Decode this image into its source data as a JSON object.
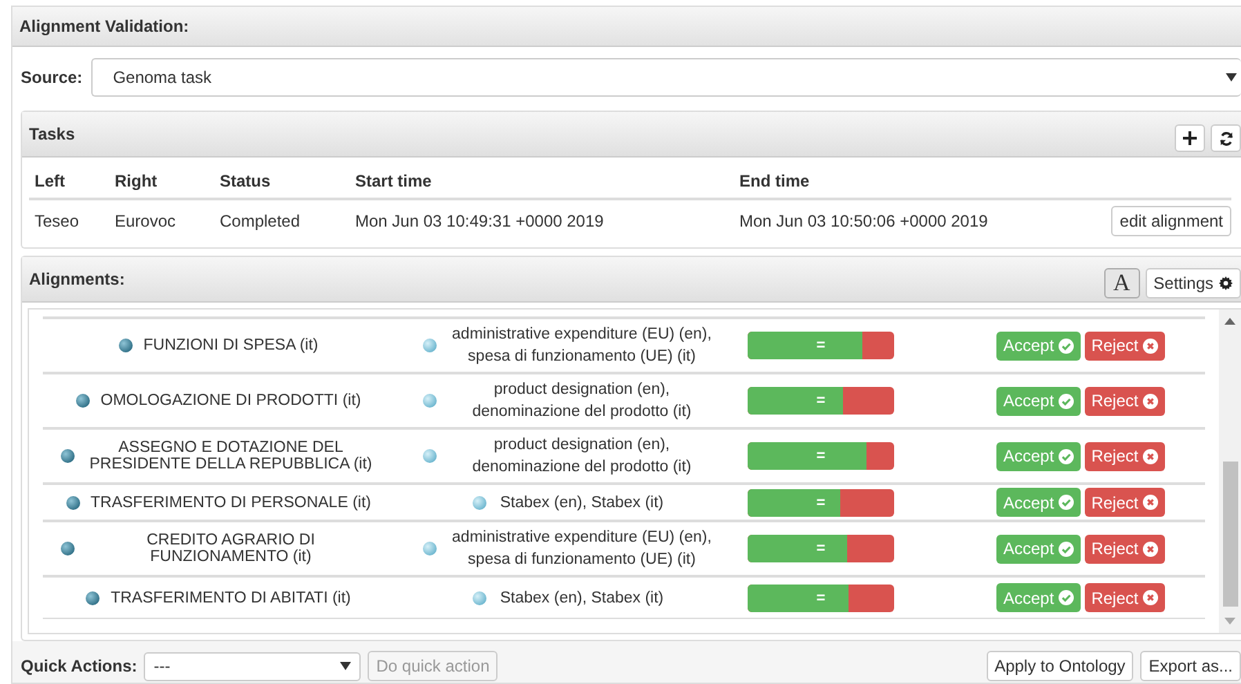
{
  "title": "Alignment Validation:",
  "source": {
    "label": "Source:",
    "value": "Genoma task"
  },
  "tasks": {
    "title": "Tasks",
    "columns": [
      "Left",
      "Right",
      "Status",
      "Start time",
      "End time"
    ],
    "rows": [
      {
        "cells": [
          "Teseo",
          "Eurovoc",
          "Completed",
          "Mon Jun 03 10:49:31 +0000 2019",
          "Mon Jun 03 10:50:06 +0000 2019"
        ],
        "action": "edit alignment"
      }
    ]
  },
  "alignments": {
    "title": "Alignments:",
    "font_button": "A",
    "settings": "Settings",
    "rows": [
      {
        "left": "FUNZIONI DI SPESA (it)",
        "right": "administrative expenditure (EU) (en), spesa di funzionamento (UE) (it)",
        "relation": "=",
        "level": 0.78,
        "accept": "Accept",
        "reject": "Reject"
      },
      {
        "left": "OMOLOGAZIONE DI PRODOTTI (it)",
        "right": "product designation (en), denominazione del prodotto (it)",
        "relation": "=",
        "level": 0.65,
        "accept": "Accept",
        "reject": "Reject"
      },
      {
        "left": "ASSEGNO E DOTAZIONE DEL PRESIDENTE DELLA REPUBBLICA (it)",
        "right": "product designation (en), denominazione del prodotto (it)",
        "relation": "=",
        "level": 0.81,
        "accept": "Accept",
        "reject": "Reject"
      },
      {
        "left": "TRASFERIMENTO DI PERSONALE (it)",
        "right": "Stabex (en), Stabex (it)",
        "relation": "=",
        "level": 0.63,
        "accept": "Accept",
        "reject": "Reject"
      },
      {
        "left": "CREDITO AGRARIO DI FUNZIONAMENTO (it)",
        "right": "administrative expenditure (EU) (en), spesa di funzionamento (UE) (it)",
        "relation": "=",
        "level": 0.68,
        "accept": "Accept",
        "reject": "Reject"
      },
      {
        "left": "TRASFERIMENTO DI ABITATI (it)",
        "right": "Stabex (en), Stabex (it)",
        "relation": "=",
        "level": 0.69,
        "accept": "Accept",
        "reject": "Reject"
      }
    ]
  },
  "footer": {
    "label": "Quick Actions:",
    "select": "---",
    "do_action": "Do quick action",
    "do_action_disabled": true,
    "apply": "Apply to Ontology",
    "export": "Export as..."
  }
}
